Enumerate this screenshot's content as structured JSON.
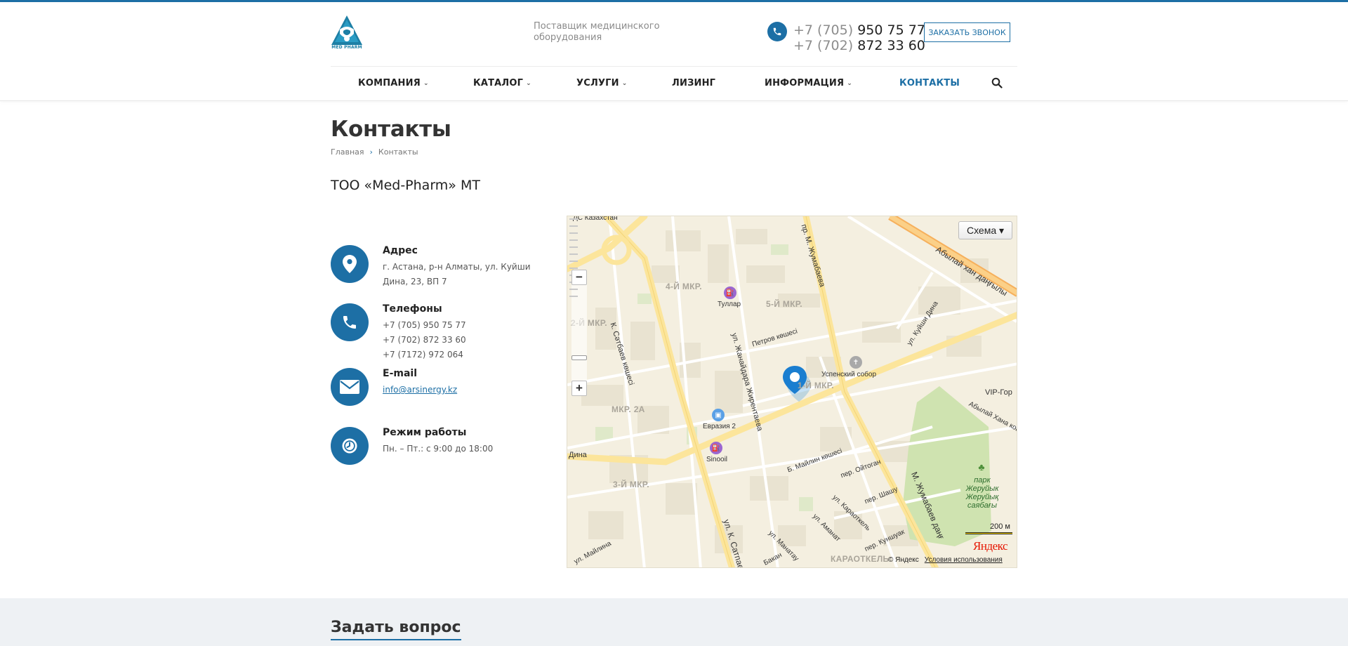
{
  "brand": {
    "logo_text": "MED PHARM",
    "accent": "#1d6fa5"
  },
  "header": {
    "tagline": "Поставщик медицинского оборудования",
    "phones": [
      {
        "code": "+7 (705)",
        "number": "950 75 77"
      },
      {
        "code": "+7 (702)",
        "number": "872 33 60"
      }
    ],
    "callback_label": "ЗАКАЗАТЬ ЗВОНОК"
  },
  "nav": {
    "items": [
      {
        "label": "КОМПАНИЯ",
        "has_dropdown": true
      },
      {
        "label": "КАТАЛОГ",
        "has_dropdown": true
      },
      {
        "label": "УСЛУГИ",
        "has_dropdown": true
      },
      {
        "label": "ЛИЗИНГ",
        "has_dropdown": false
      },
      {
        "label": "ИНФОРМАЦИЯ",
        "has_dropdown": true
      },
      {
        "label": "КОНТАКТЫ",
        "has_dropdown": false,
        "active": true
      }
    ],
    "search_icon": "search-icon"
  },
  "page": {
    "title": "Контакты",
    "breadcrumb": [
      "Главная",
      "Контакты"
    ],
    "company": "ТОО «Med-Pharm» MT"
  },
  "contacts": {
    "address": {
      "title": "Адрес",
      "text": "г. Астана, р-н Алматы, ул. Куйши Дина, 23, ВП 7"
    },
    "phones": {
      "title": "Телефоны",
      "lines": [
        "+7 (705) 950 75 77",
        "+7 (702) 872 33 60",
        "+7 (7172) 972 064"
      ]
    },
    "email": {
      "title": "E-mail",
      "value": "info@arsinergy.kz"
    },
    "hours": {
      "title": "Режим работы",
      "text": "Пн. – Пт.: с 9:00 до 18:00"
    }
  },
  "map": {
    "type_button": "Схема ▾",
    "zoom_in": "+",
    "zoom_out": "−",
    "streets": [
      "К. Сәтбаев көшесі",
      "пр. М. Жумабаева",
      "Абылай хан даңғылы",
      "ул. Жанайдара Жирентаева",
      "Петров көшесі",
      "ул. Куйши Дина",
      "Абылай Хана кош",
      "Б. Майлин көшесі",
      "пер. Ойтоган",
      "пер. Шашу",
      "ул. Караоткель",
      "ул. Аманат",
      "пер. Куншуак",
      "М. Жумабаев даңғ",
      "ул. К. Сатпаев",
      "ул. Манатау",
      "Бакан",
      "ул. Майлина",
      "Дина",
      "ДС Казахстан",
      "VIP-Гор"
    ],
    "districts": [
      "4-Й МКР.",
      "5-Й МКР.",
      "2-Й МКР.",
      "1-Й МКР.",
      "МКР. 2А",
      "3-Й МКР.",
      "КАРАОТКЕЛЬ"
    ],
    "pois": [
      "Туллар",
      "Успенский собор",
      "Евразия 2",
      "Sinooil"
    ],
    "park": "парк Жеруйык Жеруйық саябағы",
    "scale": "200 м",
    "logo": "Яндекс",
    "copyright": "© Яндекс",
    "terms": "Условия использования"
  },
  "ask": {
    "title": "Задать вопрос"
  }
}
